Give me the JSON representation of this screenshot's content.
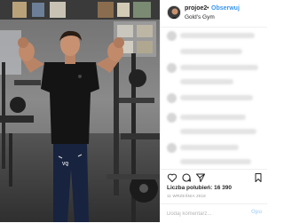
{
  "post": {
    "username": "projoe2",
    "separator": "•",
    "follow_label": "Obserwuj",
    "location": "Gold's Gym",
    "likes_text": "Liczba polubień: 16 390",
    "date": "11 WRZEŚNIA 2018",
    "comment_placeholder": "Dodaj komentarz...",
    "publish_label": "Opu"
  },
  "icons": [
    "heart-icon",
    "comment-icon",
    "share-icon",
    "bookmark-icon"
  ],
  "colors": {
    "link": "#3897f0",
    "text": "#262626",
    "muted": "#999999",
    "border": "#efefef"
  }
}
